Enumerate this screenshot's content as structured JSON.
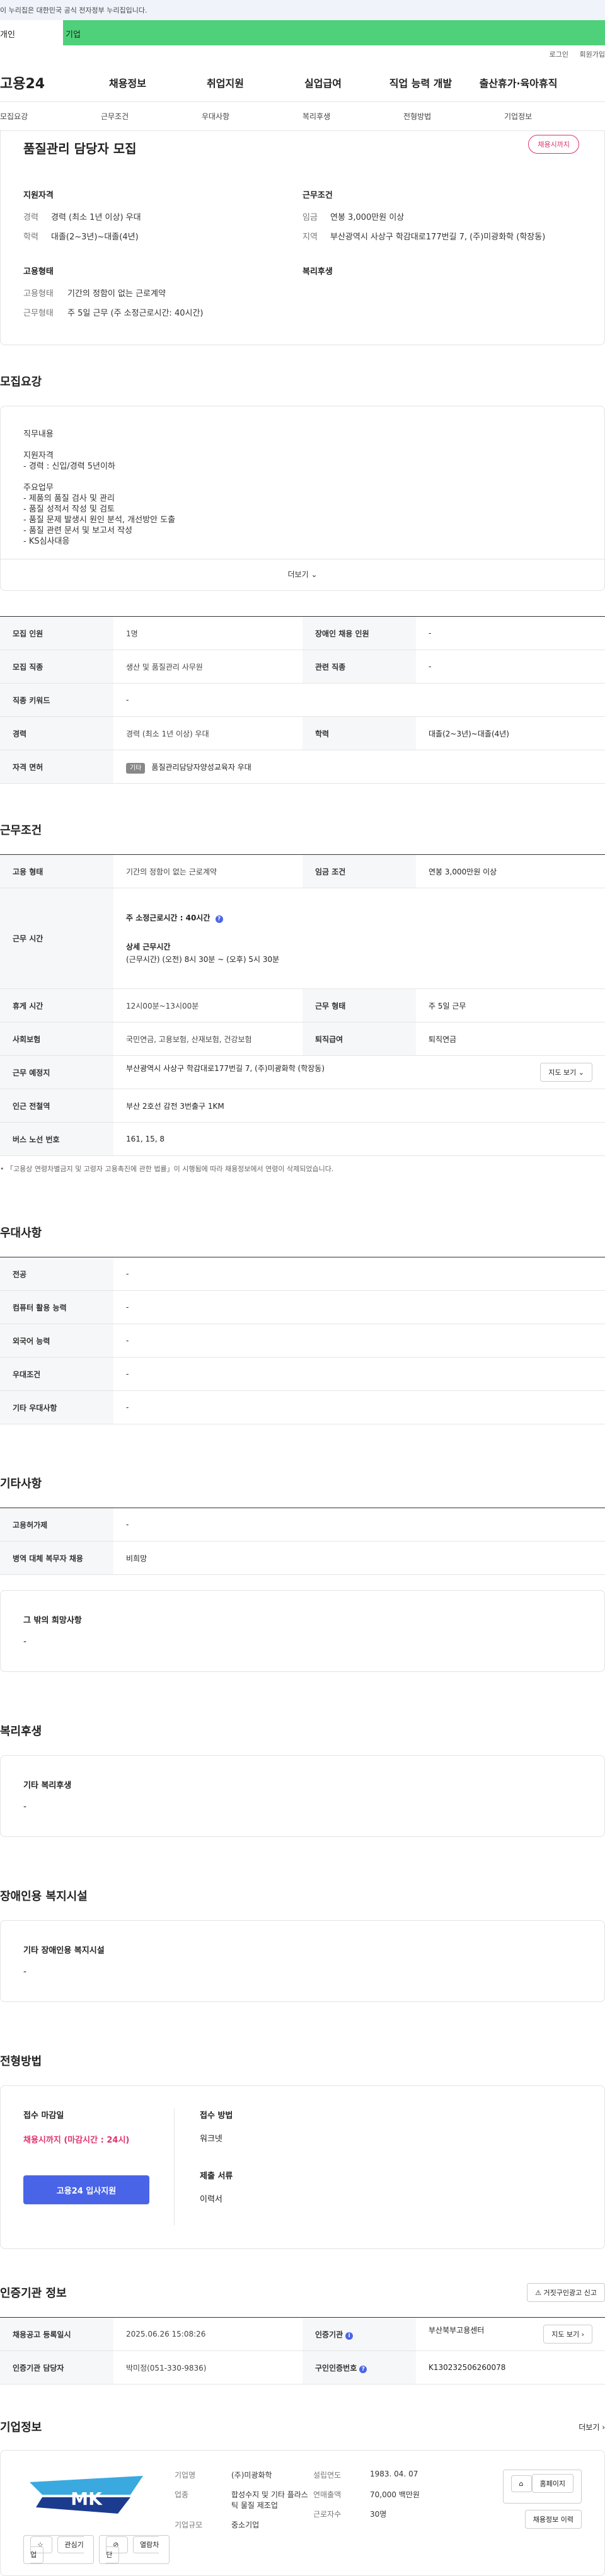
{
  "gov_banner": "이 누리집은 대한민국 공식 전자정부 누리집입니다.",
  "tabs": {
    "personal": "개인",
    "corporate": "기업"
  },
  "util": {
    "login": "로그인",
    "signup": "회원가입"
  },
  "logo": "고용24",
  "gnb": [
    "채용정보",
    "취업지원",
    "실업급여",
    "직업 능력 개발",
    "출산휴가·육아휴직"
  ],
  "anchor_nav": [
    "모집요강",
    "근무조건",
    "우대사항",
    "복리후생",
    "전형방법",
    "기업정보"
  ],
  "summary": {
    "title": "품질관리 담당자 모집",
    "status": "채용시까지",
    "qualification_heading": "지원자격",
    "career_label": "경력",
    "career_value": "경력 (최소 1년 이상) 우대",
    "education_label": "학력",
    "education_value": "대졸(2~3년)~대졸(4년)",
    "conditions_heading": "근무조건",
    "wage_label": "임금",
    "wage_value": "연봉 3,000만원 이상",
    "region_label": "지역",
    "region_value": "부산광역시 사상구 학감대로177번길 7, (주)미광화학 (학장동)",
    "employment_heading": "고용형태",
    "emp_type_label": "고용형태",
    "emp_type_value": "기간의 정함이 없는 근로계약",
    "work_type_label": "근무형태",
    "work_type_value": "주 5일 근무 (주 소정근로시간: 40시간)",
    "welfare_heading": "복리후생"
  },
  "recruit": {
    "section_title": "모집요강",
    "desc_lines": [
      "직무내용",
      "",
      "지원자격",
      "- 경력 : 신입/경력 5년이하",
      "",
      "주요업무",
      "- 제품의 품질 검사 및 관리",
      "- 품질 성적서 작성 및 검토",
      "- 품질 문제 발생시 원인 분석, 개선방안 도출",
      "- 품질 관련 문서 및 보고서 작성",
      "- KS심사대응"
    ],
    "more_label": "더보기",
    "rows": [
      [
        "모집 인원",
        "1명",
        "장애인 채용 인원",
        "-"
      ],
      [
        "모집 직종",
        "생산 및 품질관리 사무원",
        "관련 직종",
        "-"
      ],
      [
        "직종 키워드",
        "-",
        "",
        ""
      ],
      [
        "경력",
        "경력 (최소 1년 이상) 우대",
        "학력",
        "대졸(2~3년)~대졸(4년)"
      ]
    ],
    "license_label": "자격 면허",
    "license_badge": "기타",
    "license_value": "품질관리담당자양성교육자 우대"
  },
  "conditions": {
    "section_title": "근무조건",
    "emp_type_label": "고용 형태",
    "emp_type_value": "기간의 정함이 없는 근로계약",
    "wage_label": "임금 조건",
    "wage_value": "연봉 3,000만원 이상",
    "hours_label": "근무 시간",
    "weekly_hours": "주 소정근로시간 : 40시간",
    "detail_hours_title": "상세 근무시간",
    "detail_hours": "(근무시간) (오전) 8시 30분 ~ (오후) 5시 30분",
    "rest_label": "휴게 시간",
    "rest_value": "12시00분~13시00분",
    "work_form_label": "근무 형태",
    "work_form_value": "주 5일 근무",
    "insurance_label": "사회보험",
    "insurance_value": "국민연금, 고용보험, 산재보험, 건강보험",
    "retire_label": "퇴직급여",
    "retire_value": "퇴직연금",
    "place_label": "근무 예정지",
    "place_value": "부산광역시 사상구 학감대로177번길 7, (주)미광화학 (학장동)",
    "map_btn": "지도 보기",
    "station_label": "인근 전철역",
    "station_value": "부산 2호선 감전 3번출구 1KM",
    "bus_label": "버스 노선 번호",
    "bus_value": "161, 15, 8",
    "note": "「고용상 연령차별금지 및 고령자 고용촉진에 관한 법률」이 시행됨에 따라 채용정보에서 연령이 삭제되었습니다."
  },
  "preference": {
    "section_title": "우대사항",
    "rows": [
      [
        "전공",
        "-"
      ],
      [
        "컴퓨터 활용 능력",
        "-"
      ],
      [
        "외국어 능력",
        "-"
      ],
      [
        "우대조건",
        "-"
      ],
      [
        "기타 우대사항",
        "-"
      ]
    ]
  },
  "etc": {
    "section_title": "기타사항",
    "rows": [
      [
        "고용허가제",
        "-"
      ],
      [
        "병역 대체 복무자 채용",
        "비희망"
      ]
    ],
    "wish_title": "그 밖의 희망사항",
    "wish_value": "-"
  },
  "welfare": {
    "section_title": "복리후생",
    "box_title": "기타 복리후생",
    "box_value": "-"
  },
  "disability": {
    "section_title": "장애인용 복지시설",
    "box_title": "기타 장애인용 복지시설",
    "box_value": "-"
  },
  "process": {
    "section_title": "전형방법",
    "deadline_label": "접수 마감일",
    "deadline_value": "채용시까지 (마감시간 : 24시)",
    "apply_btn": "고용24 입사지원",
    "method_label": "접수 방법",
    "method_value": "워크넷",
    "docs_label": "제출 서류",
    "docs_value": "이력서"
  },
  "agency": {
    "section_title": "인증기관 정보",
    "report_btn": "거짓구인광고 신고",
    "reg_date_label": "채용공고 등록일시",
    "reg_date_value": "2025.06.26 15:08:26",
    "agency_label": "인증기관",
    "agency_value": "부산북부고용센터",
    "map_btn": "지도 보기",
    "manager_label": "인증기관 담당자",
    "manager_value": "박미정(051-330-9836)",
    "auth_no_label": "구인인증번호",
    "auth_no_value": "K130232506260078"
  },
  "company": {
    "section_title": "기업정보",
    "more": "더보기",
    "logo_text": "MK",
    "fav_btn": "관심기업",
    "block_btn": "열람차단",
    "name_label": "기업명",
    "name_value": "(주)미광화학",
    "industry_label": "업종",
    "industry_value": "합성수지 및 기타 플라스틱 물질 제조업",
    "size_label": "기업규모",
    "size_value": "중소기업",
    "founded_label": "설립연도",
    "founded_value": "1983. 04. 07",
    "sales_label": "연매출액",
    "sales_value": "70,000 백만원",
    "employees_label": "근로자수",
    "employees_value": "30명",
    "homepage_btn": "홈페이지",
    "jobs_btn": "채용정보 이력"
  },
  "colors": {
    "green": "#4fd07a",
    "pink": "#e0326c",
    "blue": "#4a64e8"
  }
}
